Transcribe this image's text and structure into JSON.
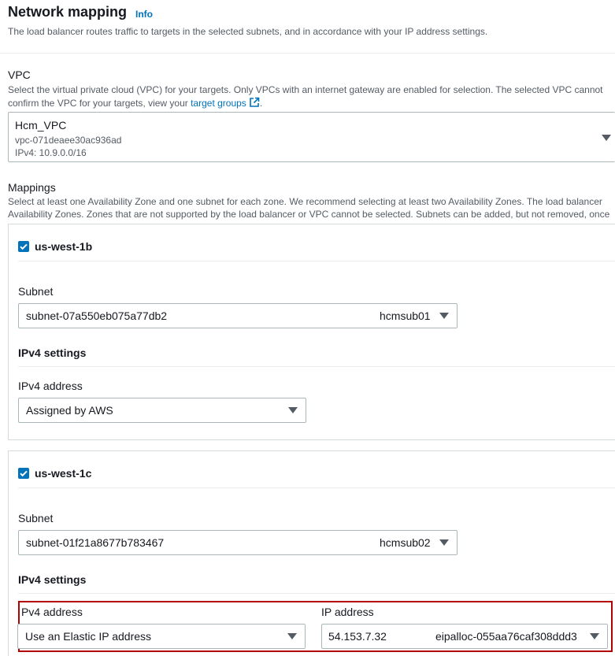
{
  "header": {
    "title": "Network mapping",
    "info": "Info",
    "description": "The load balancer routes traffic to targets in the selected subnets, and in accordance with your IP address settings."
  },
  "vpc": {
    "label": "VPC",
    "description_part1": "Select the virtual private cloud (VPC) for your targets. Only VPCs with an internet gateway are enabled for selection. The selected VPC cannot",
    "description_part2_prefix": "confirm the VPC for your targets, view your ",
    "description_link": "target groups",
    "description_suffix": ".",
    "selected_name": "Hcm_VPC",
    "selected_id": "vpc-071deaee30ac936ad",
    "selected_cidr": "IPv4: 10.9.0.0/16"
  },
  "mappings": {
    "label": "Mappings",
    "description_line1": "Select at least one Availability Zone and one subnet for each zone. We recommend selecting at least two Availability Zones. The load balancer",
    "description_line2": "Availability Zones. Zones that are not supported by the load balancer or VPC cannot be selected. Subnets can be added, but not removed, once",
    "zones": [
      {
        "name": "us-west-1b",
        "subnet_label": "Subnet",
        "subnet_id": "subnet-07a550eb075a77db2",
        "subnet_name": "hcmsub01",
        "ipv4_settings_label": "IPv4 settings",
        "ipv4_address_label": "IPv4 address",
        "ipv4_address_value": "Assigned by AWS"
      },
      {
        "name": "us-west-1c",
        "subnet_label": "Subnet",
        "subnet_id": "subnet-01f21a8677b783467",
        "subnet_name": "hcmsub02",
        "ipv4_settings_label": "IPv4 settings",
        "ipv4_address_label": "Pv4 address",
        "ipv4_address_value": "Use an Elastic IP address",
        "ip_address_label": "IP address",
        "ip_address_value": "54.153.7.32",
        "ip_address_alloc": "eipalloc-055aa76caf308ddd3"
      }
    ]
  },
  "icons": {
    "external_link": "external-link-icon",
    "caret": "caret-down-icon",
    "checkbox": "checkmark-icon"
  },
  "colors": {
    "link": "#0073bb",
    "checkbox": "#0073bb",
    "highlight": "#b30000"
  }
}
